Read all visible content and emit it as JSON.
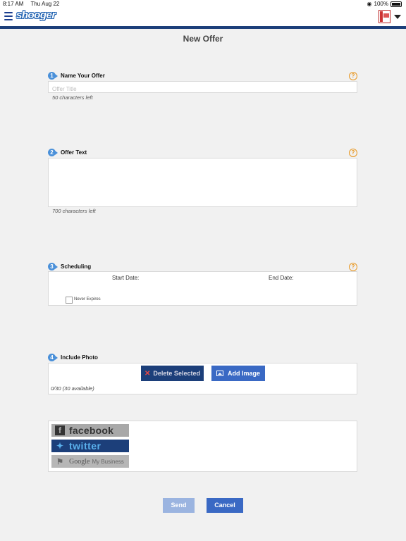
{
  "status_bar": {
    "time": "8:17 AM",
    "date": "Thu Aug 22",
    "battery": "100%"
  },
  "navbar": {
    "logo": "shooger",
    "icons": [
      "menu-icon",
      "account-icon",
      "caret-down-icon"
    ]
  },
  "page": {
    "title": "New Offer"
  },
  "sections": {
    "name": {
      "number": "1",
      "label": "Name Your Offer",
      "placeholder": "Offer Title",
      "value": "",
      "hint": "50 characters left"
    },
    "text": {
      "number": "2",
      "label": "Offer Text",
      "value": "",
      "hint": "700 characters left"
    },
    "scheduling": {
      "number": "3",
      "label": "Scheduling",
      "start_label": "Start Date:",
      "end_label": "End Date:",
      "never_expires": "Never Expires",
      "never_expires_checked": false
    },
    "photo": {
      "number": "4",
      "label": "Include Photo",
      "delete_label": "Delete Selected",
      "add_label": "Add Image",
      "count": "0/30 (30 available)"
    }
  },
  "social": {
    "facebook": "facebook",
    "twitter": "twitter",
    "google_main": "Google",
    "google_sub": "My Business"
  },
  "footer": {
    "send_label": "Send",
    "cancel_label": "Cancel"
  },
  "colors": {
    "nav_blue": "#1c3f7a",
    "accent_blue": "#3a69c4",
    "step_blue": "#4a90d9",
    "help_orange": "#e8961e"
  }
}
